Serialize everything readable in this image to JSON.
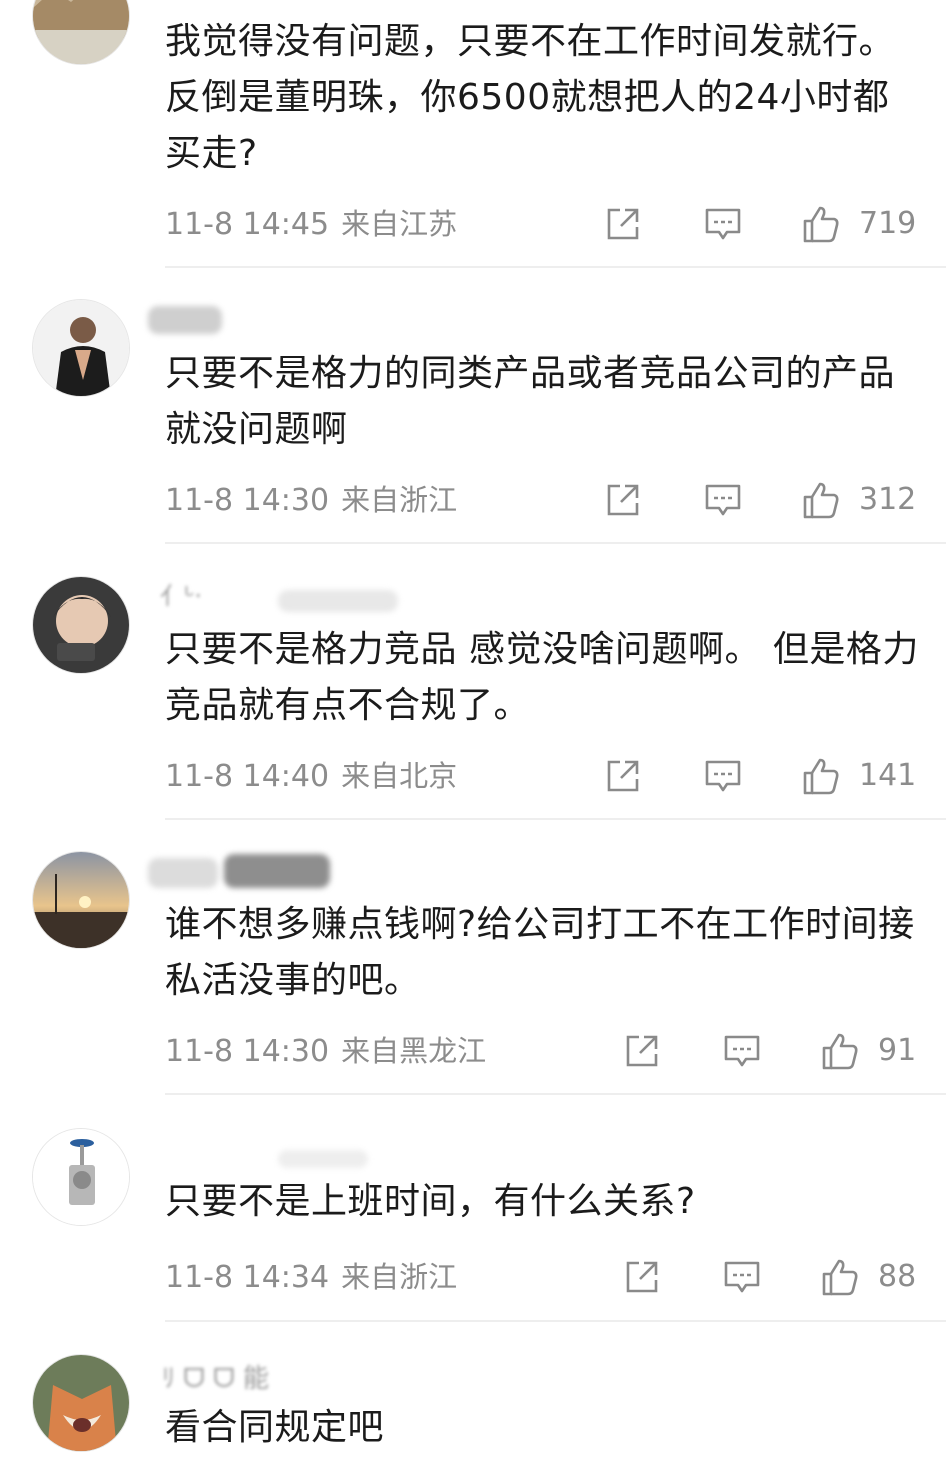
{
  "comments": [
    {
      "username": "",
      "text": "我觉得没有问题，只要不在工作时间发就行。反倒是董明珠，你6500就想把人的24小时都买走?",
      "time": "11-8 14:45",
      "location": "来自江苏",
      "likes": "719"
    },
    {
      "username": "",
      "text": "只要不是格力的同类产品或者竞品公司的产品就没问题啊",
      "time": "11-8 14:30",
      "location": "来自浙江",
      "likes": "312"
    },
    {
      "username": "",
      "text": "只要不是格力竞品 感觉没啥问题啊。 但是格力竞品就有点不合规了。",
      "time": "11-8 14:40",
      "location": "来自北京",
      "likes": "141"
    },
    {
      "username": "",
      "text": "谁不想多赚点钱啊?给公司打工不在工作时间接私活没事的吧。",
      "time": "11-8 14:30",
      "location": "来自黑龙江",
      "likes": "91"
    },
    {
      "username": "",
      "text": "只要不是上班时间，有什么关系?",
      "time": "11-8 14:34",
      "location": "来自浙江",
      "likes": "88"
    },
    {
      "username": "",
      "text": "看合同规定吧",
      "time": "",
      "location": "",
      "likes": ""
    }
  ],
  "icons": {
    "share": "share-icon",
    "reply": "comment-icon",
    "like": "thumbs-up-icon"
  },
  "colors": {
    "text": "#1b1b1b",
    "meta": "#8c8c8c",
    "divider": "#eeeeee"
  }
}
